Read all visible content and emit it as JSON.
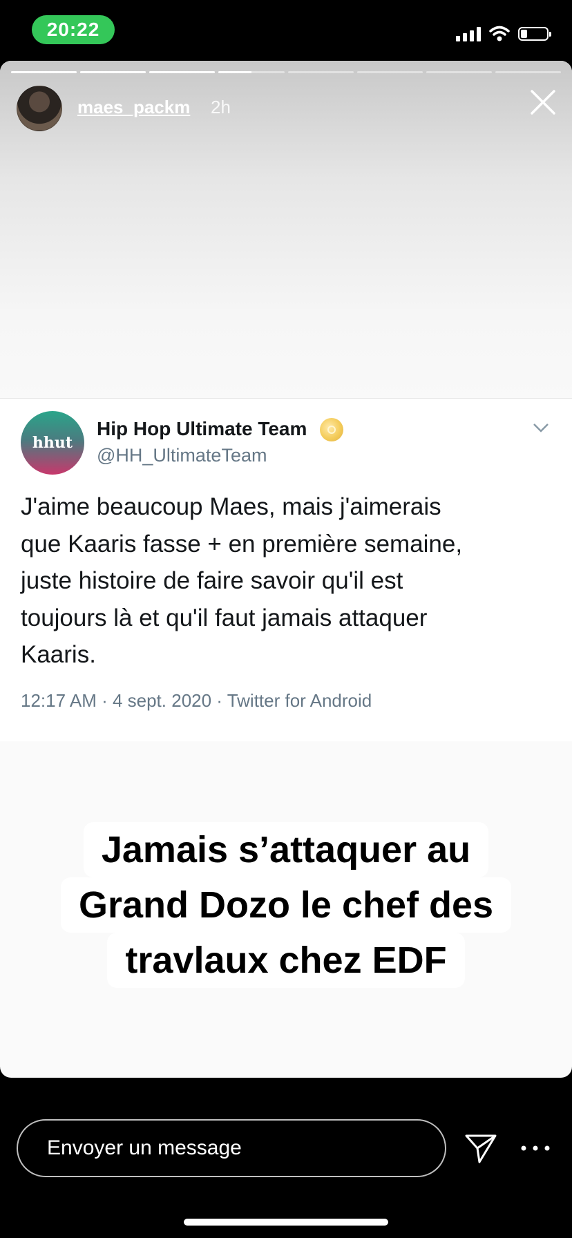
{
  "status_bar": {
    "time": "20:22",
    "battery_level": 0.2,
    "icons": [
      "signal-icon",
      "wifi-icon",
      "battery-icon"
    ]
  },
  "story": {
    "progress": {
      "segments": 8,
      "completed": 3,
      "current_fraction": 0.5
    },
    "user": {
      "username": "maes_packm",
      "time_ago": "2h"
    },
    "close_icon": "close-icon"
  },
  "tweet": {
    "avatar_text": "hhut",
    "display_name": "Hip Hop Ultimate Team",
    "handle": "@HH_UltimateTeam",
    "badge_icon": "gold-record-icon",
    "text_lines": [
      "J'aime beaucoup Maes, mais j'aimerais",
      "que Kaaris fasse + en première semaine,",
      "juste histoire de faire savoir qu'il est",
      "toujours là et qu'il faut jamais attaquer",
      "Kaaris."
    ],
    "meta": "12:17 AM · 4 sept. 2020 · Twitter for Android"
  },
  "caption_lines": [
    "Jamais s’attaquer au",
    "Grand Dozo le chef des",
    "travlaux chez EDF"
  ],
  "bottom_bar": {
    "message_placeholder": "Envoyer un message",
    "send_icon": "paper-plane-icon",
    "more_icon": "more-dots-icon"
  },
  "colors": {
    "status_green": "#34c759",
    "tweet_handle": "#657786",
    "tweet_text": "#14171a"
  }
}
